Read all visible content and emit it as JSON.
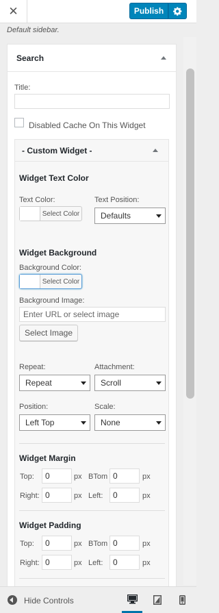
{
  "header": {
    "publish_label": "Publish"
  },
  "description": "Default sidebar.",
  "widget": {
    "title": "Search",
    "title_field_label": "Title:",
    "title_value": "",
    "cache_label": "Disabled Cache On This Widget"
  },
  "custom_widget": {
    "title": "- Custom Widget -",
    "text_color_section": "Widget Text Color",
    "text_color_label": "Text Color:",
    "select_color": "Select Color",
    "text_position_label": "Text Position:",
    "text_position_value": "Defaults",
    "background_section": "Widget Background",
    "background_color_label": "Background Color:",
    "background_image_label": "Background Image:",
    "background_image_placeholder": "Enter URL or select image",
    "select_image_label": "Select Image",
    "repeat_label": "Repeat:",
    "repeat_value": "Repeat",
    "attachment_label": "Attachment:",
    "attachment_value": "Scroll",
    "position_label": "Position:",
    "position_value": "Left Top",
    "scale_label": "Scale:",
    "scale_value": "None",
    "margin_section": "Widget Margin",
    "padding_section": "Widget Padding",
    "top_label": "Top:",
    "bottom_label": "BTom",
    "right_label": "Right:",
    "left_label": "Left:",
    "unit": "px",
    "margin": {
      "top": "0",
      "bottom": "0",
      "right": "0",
      "left": "0"
    },
    "padding": {
      "top": "0",
      "bottom": "0",
      "right": "0",
      "left": "0"
    }
  },
  "footer": {
    "hide_controls_label": "Hide Controls"
  },
  "colors": {
    "accent": "#0085ba",
    "focus": "#5b9dd9"
  }
}
